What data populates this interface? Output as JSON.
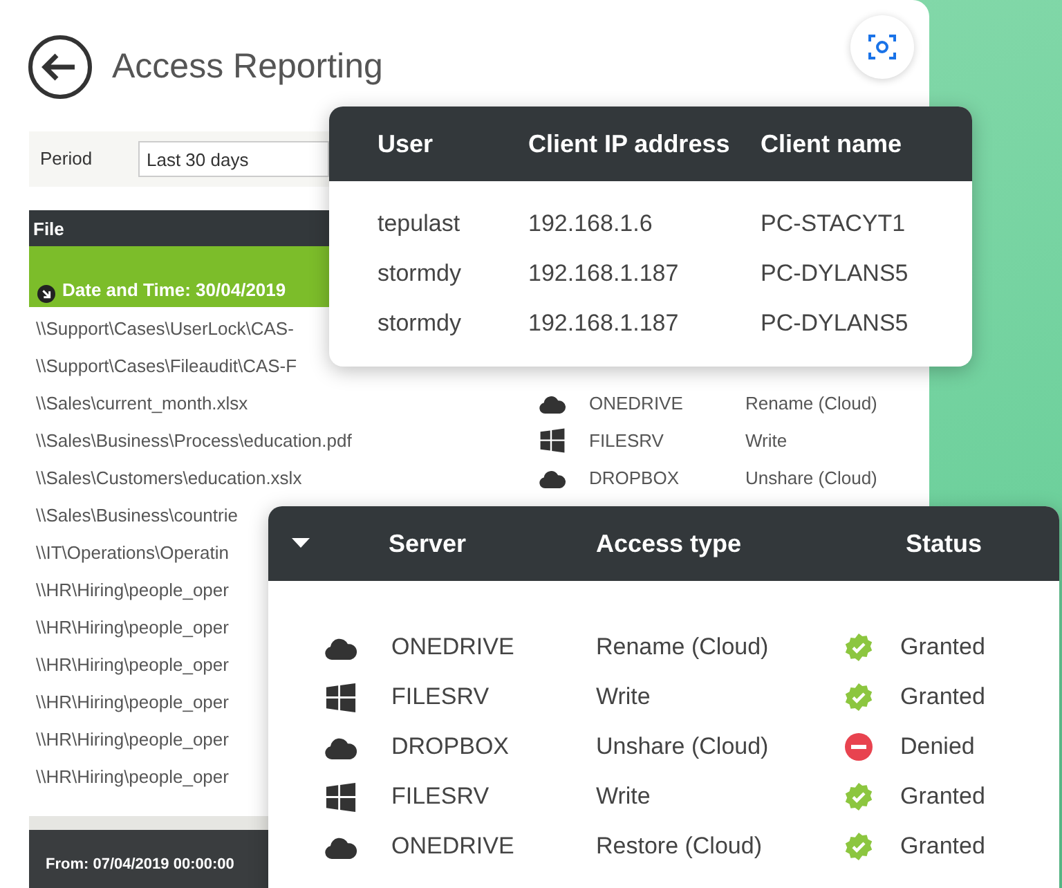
{
  "header": {
    "title": "Access Reporting"
  },
  "filter": {
    "label": "Period",
    "value": "Last 30 days"
  },
  "file_table": {
    "column": "File",
    "group": "Date and Time: 30/04/2019",
    "rows": [
      {
        "file": "\\\\Support\\Cases\\UserLock\\CAS-"
      },
      {
        "file": "\\\\Support\\Cases\\Fileaudit\\CAS-F"
      },
      {
        "file": "\\\\Sales\\current_month.xlsx",
        "kind": "cloud",
        "server": "ONEDRIVE",
        "access": "Rename (Cloud)"
      },
      {
        "file": "\\\\Sales\\Business\\Process\\education.pdf",
        "kind": "windows",
        "server": "FILESRV",
        "access": "Write"
      },
      {
        "file": "\\\\Sales\\Customers\\education.xslx",
        "kind": "cloud",
        "server": "DROPBOX",
        "access": "Unshare (Cloud)"
      },
      {
        "file": "\\\\Sales\\Business\\countrie"
      },
      {
        "file": "\\\\IT\\Operations\\Operatin"
      },
      {
        "file": "\\\\HR\\Hiring\\people_oper"
      },
      {
        "file": "\\\\HR\\Hiring\\people_oper"
      },
      {
        "file": "\\\\HR\\Hiring\\people_oper"
      },
      {
        "file": "\\\\HR\\Hiring\\people_oper"
      },
      {
        "file": "\\\\HR\\Hiring\\people_oper"
      },
      {
        "file": "\\\\HR\\Hiring\\people_oper"
      }
    ]
  },
  "footer": {
    "text": "From: 07/04/2019 00:00:00"
  },
  "client_popup": {
    "columns": [
      "User",
      "Client IP address",
      "Client name"
    ],
    "rows": [
      [
        "tepulast",
        "192.168.1.6",
        "PC-STACYT1"
      ],
      [
        "stormdy",
        "192.168.1.187",
        "PC-DYLANS5"
      ],
      [
        "stormdy",
        "192.168.1.187",
        "PC-DYLANS5"
      ]
    ]
  },
  "server_popup": {
    "columns": [
      "Server",
      "Access type",
      "Status"
    ],
    "rows": [
      {
        "kind": "cloud",
        "server": "ONEDRIVE",
        "access": "Rename (Cloud)",
        "granted": true,
        "status": "Granted"
      },
      {
        "kind": "windows",
        "server": "FILESRV",
        "access": "Write",
        "granted": true,
        "status": "Granted"
      },
      {
        "kind": "cloud",
        "server": "DROPBOX",
        "access": "Unshare (Cloud)",
        "granted": false,
        "status": "Denied"
      },
      {
        "kind": "windows",
        "server": "FILESRV",
        "access": "Write",
        "granted": true,
        "status": "Granted"
      },
      {
        "kind": "cloud",
        "server": "ONEDRIVE",
        "access": "Restore (Cloud)",
        "granted": true,
        "status": "Granted"
      }
    ]
  }
}
